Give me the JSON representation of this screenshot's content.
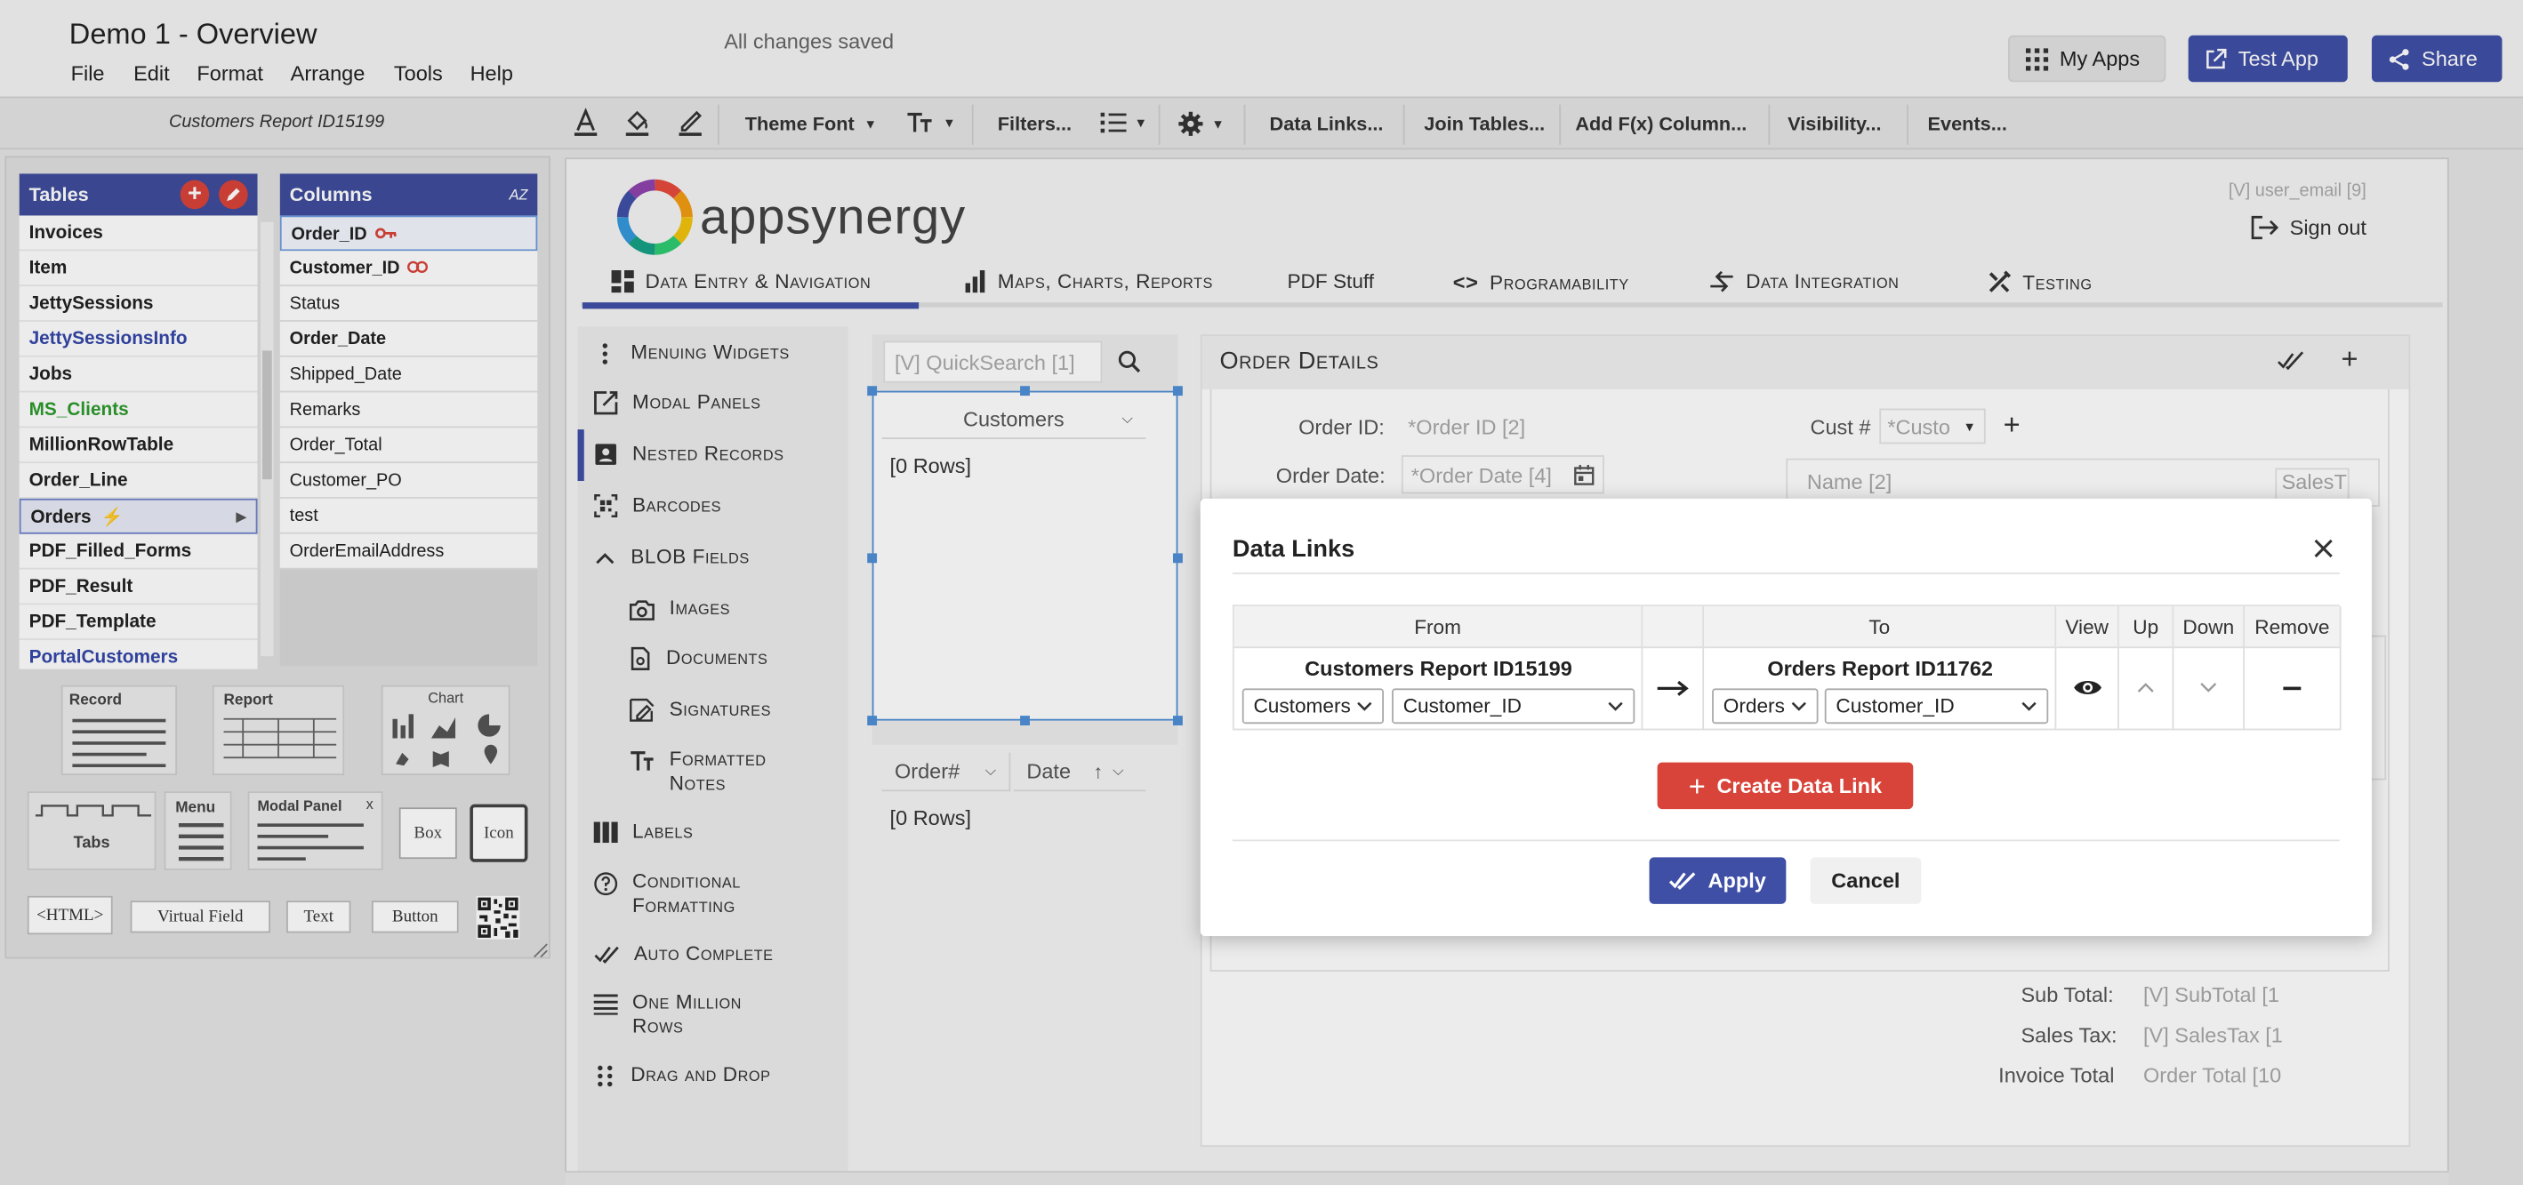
{
  "app": {
    "title": "Demo 1 - Overview",
    "save_status": "All changes saved",
    "menu": [
      "File",
      "Edit",
      "Format",
      "Arrange",
      "Tools",
      "Help"
    ],
    "header_buttons": {
      "my_apps": "My Apps",
      "test_app": "Test App",
      "share": "Share"
    }
  },
  "toolbar": {
    "report_name": "Customers Report ID15199",
    "font_label": "Theme Font",
    "filters": "Filters...",
    "data_links": "Data Links...",
    "join_tables": "Join Tables...",
    "add_fx_column": "Add F(x) Column...",
    "visibility": "Visibility...",
    "events": "Events..."
  },
  "tables_panel": {
    "title": "Tables",
    "items": [
      "Invoices",
      "Item",
      "JettySessions",
      "JettySessionsInfo",
      "Jobs",
      "MS_Clients",
      "MillionRowTable",
      "Order_Line",
      "Orders",
      "PDF_Filled_Forms",
      "PDF_Result",
      "PDF_Template",
      "PortalCustomers"
    ],
    "colors": {
      "JettySessionsInfo": "#3347a8",
      "MS_Clients": "#2d9a2d",
      "PortalCustomers": "#3347a8"
    }
  },
  "columns_panel": {
    "title": "Columns",
    "items": [
      "Order_ID",
      "Customer_ID",
      "Status",
      "Order_Date",
      "Shipped_Date",
      "Remarks",
      "Order_Total",
      "Customer_PO",
      "test",
      "OrderEmailAddress"
    ],
    "sort_label": "AZ"
  },
  "widgets": {
    "record": "Record",
    "report": "Report",
    "chart": "Chart",
    "tabs": "Tabs",
    "menu": "Menu",
    "modal_panel": "Modal Panel",
    "modal_close": "x",
    "box": "Box",
    "icon": "Icon",
    "html": "<HTML>",
    "virtual_field": "Virtual Field",
    "text": "Text",
    "button": "Button"
  },
  "canvas": {
    "logo_text": "appsynergy",
    "user_email": "[V] user_email [9]",
    "sign_out": "Sign out",
    "nav_tabs": [
      "Data Entry & Navigation",
      "Maps, Charts, Reports",
      "PDF Stuff",
      "Programability",
      "Data Integration",
      "Testing"
    ],
    "sidebar": [
      "Menuing Widgets",
      "Modal Panels",
      "Nested Records",
      "Barcodes",
      "BLOB Fields",
      "Images",
      "Documents",
      "Signatures",
      "Formatted Notes",
      "Labels",
      "Conditional Formatting",
      "Auto Complete",
      "One Million Rows",
      "Drag and Drop"
    ],
    "quicksearch_placeholder": "[V] QuickSearch [1]",
    "customers_header": "Customers",
    "rows_top": "[0 Rows]",
    "order_col": "Order#",
    "date_col": "Date",
    "rows_bottom": "[0 Rows]",
    "details": {
      "title": "Order Details",
      "order_id_label": "Order ID:",
      "order_id_ph": "*Order ID [2]",
      "order_date_label": "Order Date:",
      "order_date_ph": "*Order Date [4]",
      "cust_label": "Cust #",
      "cust_ph": "*Custo",
      "name_ph": "Name [2]",
      "salestax_ph": "SalesT",
      "sub_total_label": "Sub Total:",
      "sub_total_ph": "[V] SubTotal [1",
      "sales_tax_label": "Sales Tax:",
      "sales_tax_ph": "[V] SalesTax [1",
      "invoice_total_label": "Invoice Total",
      "invoice_total_ph": "Order Total [10"
    }
  },
  "modal": {
    "title": "Data Links",
    "headers": {
      "from": "From",
      "to": "To",
      "view": "View",
      "up": "Up",
      "down": "Down",
      "remove": "Remove"
    },
    "link": {
      "from_report": "Customers Report ID15199",
      "from_table": "Customers",
      "from_column": "Customer_ID",
      "to_report": "Orders Report ID11762",
      "to_table": "Orders",
      "to_column": "Customer_ID"
    },
    "create_label": "Create Data Link",
    "apply_label": "Apply",
    "cancel_label": "Cancel",
    "colors": {
      "create": "#d9443a",
      "apply": "#3f4fa6"
    }
  }
}
